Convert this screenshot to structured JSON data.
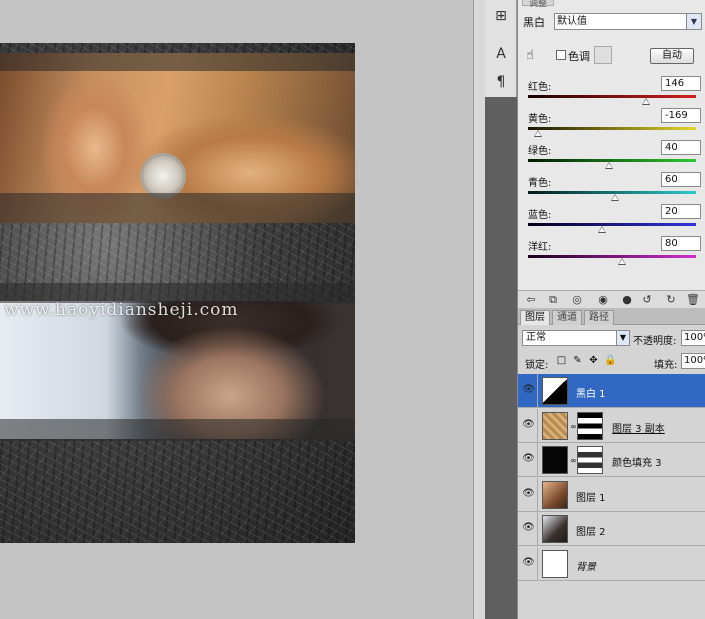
{
  "canvas": {
    "watermark": "www.haoyidiansheji.com"
  },
  "tool_strip": {
    "icons": [
      "adjust-icon",
      "character-icon",
      "paragraph-icon"
    ]
  },
  "adjustments": {
    "tab_label": "调整",
    "adjustment_name": "黑白",
    "preset_value": "默认值",
    "tint_label": "色调",
    "tint_checked": false,
    "auto_label": "自动",
    "sliders": [
      {
        "label": "红色:",
        "value": "146",
        "percent": 0.7,
        "gradient": "linear-gradient(90deg,#1a0000,#d42020)"
      },
      {
        "label": "黄色:",
        "value": "-169",
        "percent": 0.06,
        "gradient": "linear-gradient(90deg,#1a1400,#e4d62a)"
      },
      {
        "label": "绿色:",
        "value": "40",
        "percent": 0.48,
        "gradient": "linear-gradient(90deg,#001a00,#2ec82e)"
      },
      {
        "label": "青色:",
        "value": "60",
        "percent": 0.52,
        "gradient": "linear-gradient(90deg,#001a1a,#2ecaca)"
      },
      {
        "label": "蓝色:",
        "value": "20",
        "percent": 0.44,
        "gradient": "linear-gradient(90deg,#00001a,#3232e0)"
      },
      {
        "label": "洋红:",
        "value": "80",
        "percent": 0.56,
        "gradient": "linear-gradient(90deg,#1a001a,#d22ed2)"
      }
    ]
  },
  "layers": {
    "tabs": [
      "图层",
      "通道",
      "路径"
    ],
    "active_tab": 0,
    "blend_mode": "正常",
    "opacity_label": "不透明度:",
    "opacity_value": "100%",
    "lock_label": "锁定:",
    "fill_label": "填充:",
    "fill_value": "100%",
    "items": [
      {
        "name": "黑白 1",
        "kind": "adjustment",
        "selected": true
      },
      {
        "name": "图层 3 副本",
        "kind": "masked-texture",
        "selected": false
      },
      {
        "name": "颜色填充 3",
        "kind": "fill",
        "selected": false
      },
      {
        "name": "图层 1",
        "kind": "smart-photo",
        "selected": false
      },
      {
        "name": "图层 2",
        "kind": "smart-photo2",
        "selected": false
      },
      {
        "name": "背景",
        "kind": "background",
        "selected": false
      }
    ]
  },
  "colors": {
    "selection": "#3168c3",
    "panel": "#e8e8e8"
  }
}
